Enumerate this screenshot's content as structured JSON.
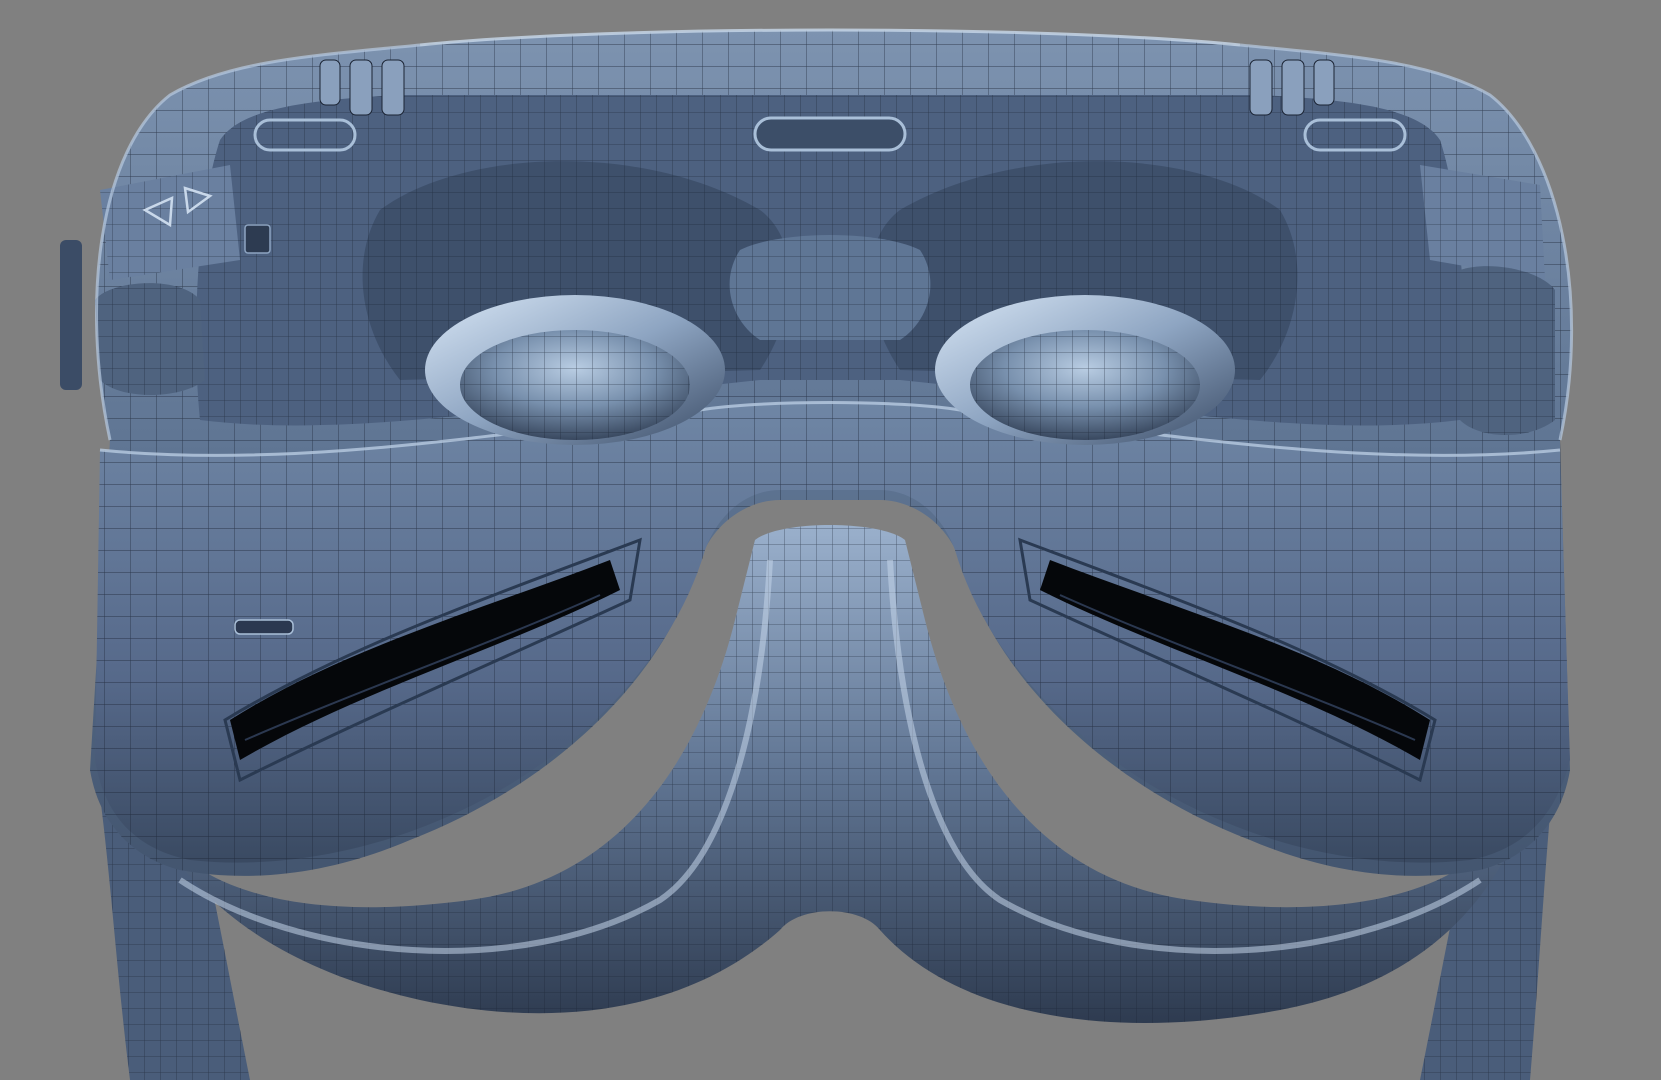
{
  "scene": {
    "subject": "vr-headset-wireframe-render",
    "background_color": "#808080",
    "shell_color": "#5b6f8c",
    "shell_dark_color": "#2c3a50",
    "highlight_color": "#a9bfd8",
    "wire_color": "#1a2333",
    "cavity_color": "#05070a"
  }
}
